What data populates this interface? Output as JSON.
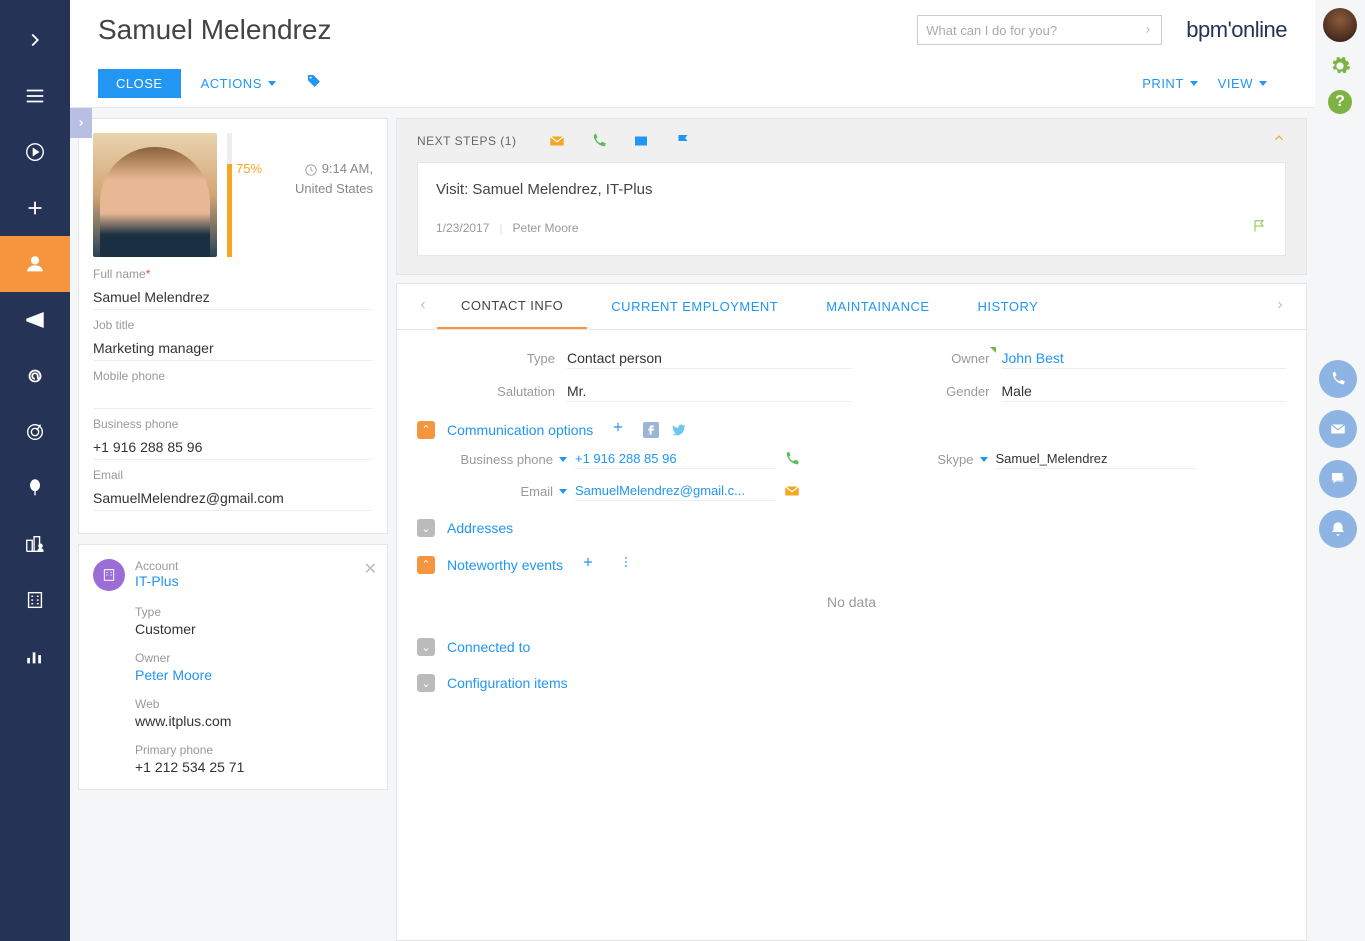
{
  "header": {
    "title": "Samuel Melendrez",
    "search_placeholder": "What can I do for you?",
    "logo": "bpm'online"
  },
  "actions": {
    "close": "CLOSE",
    "actions": "ACTIONS",
    "print": "PRINT",
    "view": "VIEW"
  },
  "profile": {
    "completeness_pct": "75%",
    "time": "9:14 AM,",
    "location": "United States",
    "full_name_label": "Full name",
    "full_name": "Samuel Melendrez",
    "job_title_label": "Job title",
    "job_title": "Marketing manager",
    "mobile_label": "Mobile phone",
    "mobile": "",
    "business_label": "Business phone",
    "business": "+1 916 288 85 96",
    "email_label": "Email",
    "email": "SamuelMelendrez@gmail.com"
  },
  "account": {
    "label": "Account",
    "name": "IT-Plus",
    "type_label": "Type",
    "type": "Customer",
    "owner_label": "Owner",
    "owner": "Peter Moore",
    "web_label": "Web",
    "web": "www.itplus.com",
    "primary_phone_label": "Primary phone",
    "primary_phone": "+1 212 534 25 71"
  },
  "next_steps": {
    "title": "NEXT STEPS (1)",
    "visit_title": "Visit: Samuel Melendrez, IT-Plus",
    "date": "1/23/2017",
    "owner": "Peter Moore"
  },
  "tabs": {
    "contact_info": "CONTACT INFO",
    "current_employment": "CURRENT EMPLOYMENT",
    "maintainance": "MAINTAINANCE",
    "history": "HISTORY"
  },
  "info": {
    "type_label": "Type",
    "type": "Contact person",
    "owner_label": "Owner",
    "owner": "John Best",
    "salutation_label": "Salutation",
    "salutation": "Mr.",
    "gender_label": "Gender",
    "gender": "Male"
  },
  "sections": {
    "comm_options": "Communication options",
    "addresses": "Addresses",
    "noteworthy": "Noteworthy events",
    "connected": "Connected to",
    "config_items": "Configuration items",
    "no_data": "No data"
  },
  "comm": {
    "business_label": "Business phone",
    "business": "+1 916 288 85 96",
    "skype_label": "Skype",
    "skype": "Samuel_Melendrez",
    "email_label": "Email",
    "email": "SamuelMelendrez@gmail.c..."
  }
}
